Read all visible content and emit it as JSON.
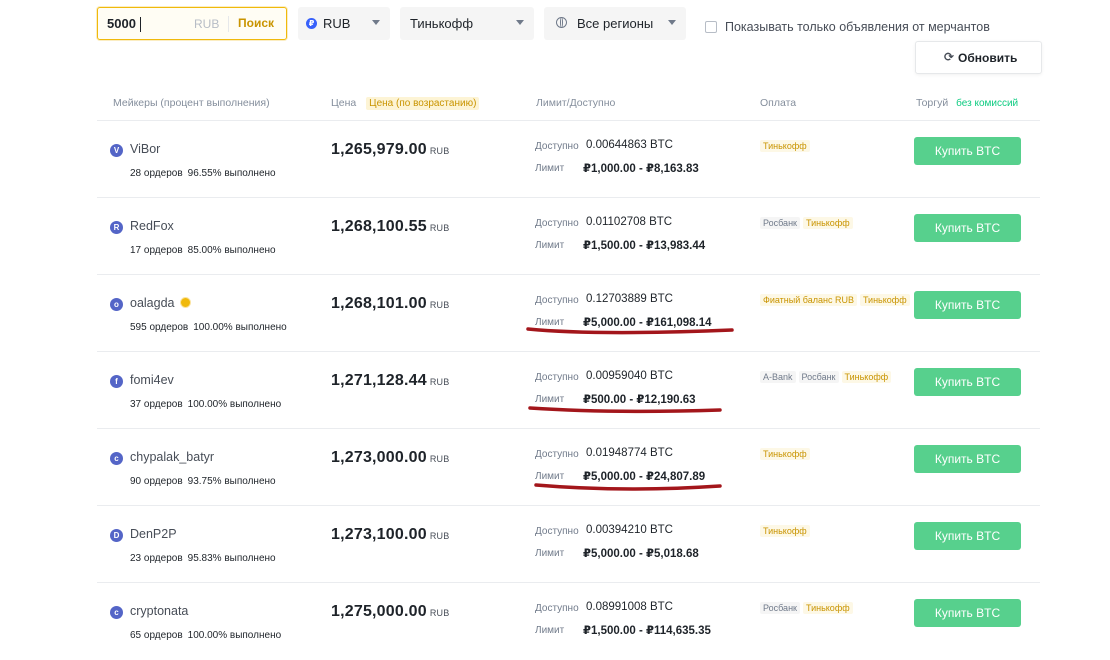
{
  "filters": {
    "amount": {
      "value": "5000",
      "currency": "RUB",
      "search_label": "Поиск"
    },
    "fiat": {
      "value": "RUB"
    },
    "payment": {
      "value": "Тинькофф"
    },
    "region": {
      "value": "Все регионы"
    },
    "merchant_only_label": "Показывать только объявления от мерчантов",
    "merchant_only_checked": false,
    "refresh_label": "Обновить"
  },
  "table_header": {
    "makers": "Мейкеры (процент выполнения)",
    "price": "Цена",
    "price_sort": "Цена (по возрастанию)",
    "limit": "Лимит/Доступно",
    "payment": "Оплата",
    "trade": "Торгуй",
    "trade_badge": "без комиссий"
  },
  "labels": {
    "available": "Доступно",
    "limit": "Лимит",
    "price_unit": "RUB"
  },
  "rows": [
    {
      "avatar": "V",
      "name": "ViBor",
      "verified": false,
      "stats": "28 ордеров",
      "completion": "96.55% выполнено",
      "price": "1,265,979.00",
      "available": "0.00644863 BTC",
      "limit": "₽1,000.00 - ₽8,163.83",
      "payments": [
        {
          "label": "Тинькофф",
          "style": "yellow"
        }
      ],
      "buy_label": "Купить BTC",
      "underlined": false
    },
    {
      "avatar": "R",
      "name": "RedFox",
      "verified": false,
      "stats": "17 ордеров",
      "completion": "85.00% выполнено",
      "price": "1,268,100.55",
      "available": "0.01102708 BTC",
      "limit": "₽1,500.00 - ₽13,983.44",
      "payments": [
        {
          "label": "Росбанк",
          "style": "gray"
        },
        {
          "label": "Тинькофф",
          "style": "yellow"
        }
      ],
      "buy_label": "Купить BTC",
      "underlined": false
    },
    {
      "avatar": "o",
      "name": "oalagda",
      "verified": true,
      "stats": "595 ордеров",
      "completion": "100.00% выполнено",
      "price": "1,268,101.00",
      "available": "0.12703889 BTC",
      "limit": "₽5,000.00 - ₽161,098.14",
      "payments": [
        {
          "label": "Фиатный баланс RUB",
          "style": "yellow"
        },
        {
          "label": "Тинькофф",
          "style": "yellow"
        }
      ],
      "buy_label": "Купить BTC",
      "underlined": true
    },
    {
      "avatar": "f",
      "name": "fomi4ev",
      "verified": false,
      "stats": "37 ордеров",
      "completion": "100.00% выполнено",
      "price": "1,271,128.44",
      "available": "0.00959040 BTC",
      "limit": "₽500.00 - ₽12,190.63",
      "payments": [
        {
          "label": "A-Bank",
          "style": "gray"
        },
        {
          "label": "Росбанк",
          "style": "gray"
        },
        {
          "label": "Тинькофф",
          "style": "yellow"
        }
      ],
      "buy_label": "Купить BTC",
      "underlined": true
    },
    {
      "avatar": "c",
      "name": "chypalak_batyr",
      "verified": false,
      "stats": "90 ордеров",
      "completion": "93.75% выполнено",
      "price": "1,273,000.00",
      "available": "0.01948774 BTC",
      "limit": "₽5,000.00 - ₽24,807.89",
      "payments": [
        {
          "label": "Тинькофф",
          "style": "yellow"
        }
      ],
      "buy_label": "Купить BTC",
      "underlined": true
    },
    {
      "avatar": "D",
      "name": "DenP2P",
      "verified": false,
      "stats": "23 ордеров",
      "completion": "95.83% выполнено",
      "price": "1,273,100.00",
      "available": "0.00394210 BTC",
      "limit": "₽5,000.00 - ₽5,018.68",
      "payments": [
        {
          "label": "Тинькофф",
          "style": "yellow"
        }
      ],
      "buy_label": "Купить BTC",
      "underlined": false
    },
    {
      "avatar": "c",
      "name": "cryptonata",
      "verified": false,
      "stats": "65 ордеров",
      "completion": "100.00% выполнено",
      "price": "1,275,000.00",
      "available": "0.08991008 BTC",
      "limit": "₽1,500.00 - ₽114,635.35",
      "payments": [
        {
          "label": "Росбанк",
          "style": "gray"
        },
        {
          "label": "Тинькофф",
          "style": "yellow"
        }
      ],
      "buy_label": "Купить BTC",
      "underlined": false
    }
  ],
  "colors": {
    "accent": "#f0b90b",
    "buy_button": "#57d08d",
    "annotation_red": "#a3161b"
  }
}
